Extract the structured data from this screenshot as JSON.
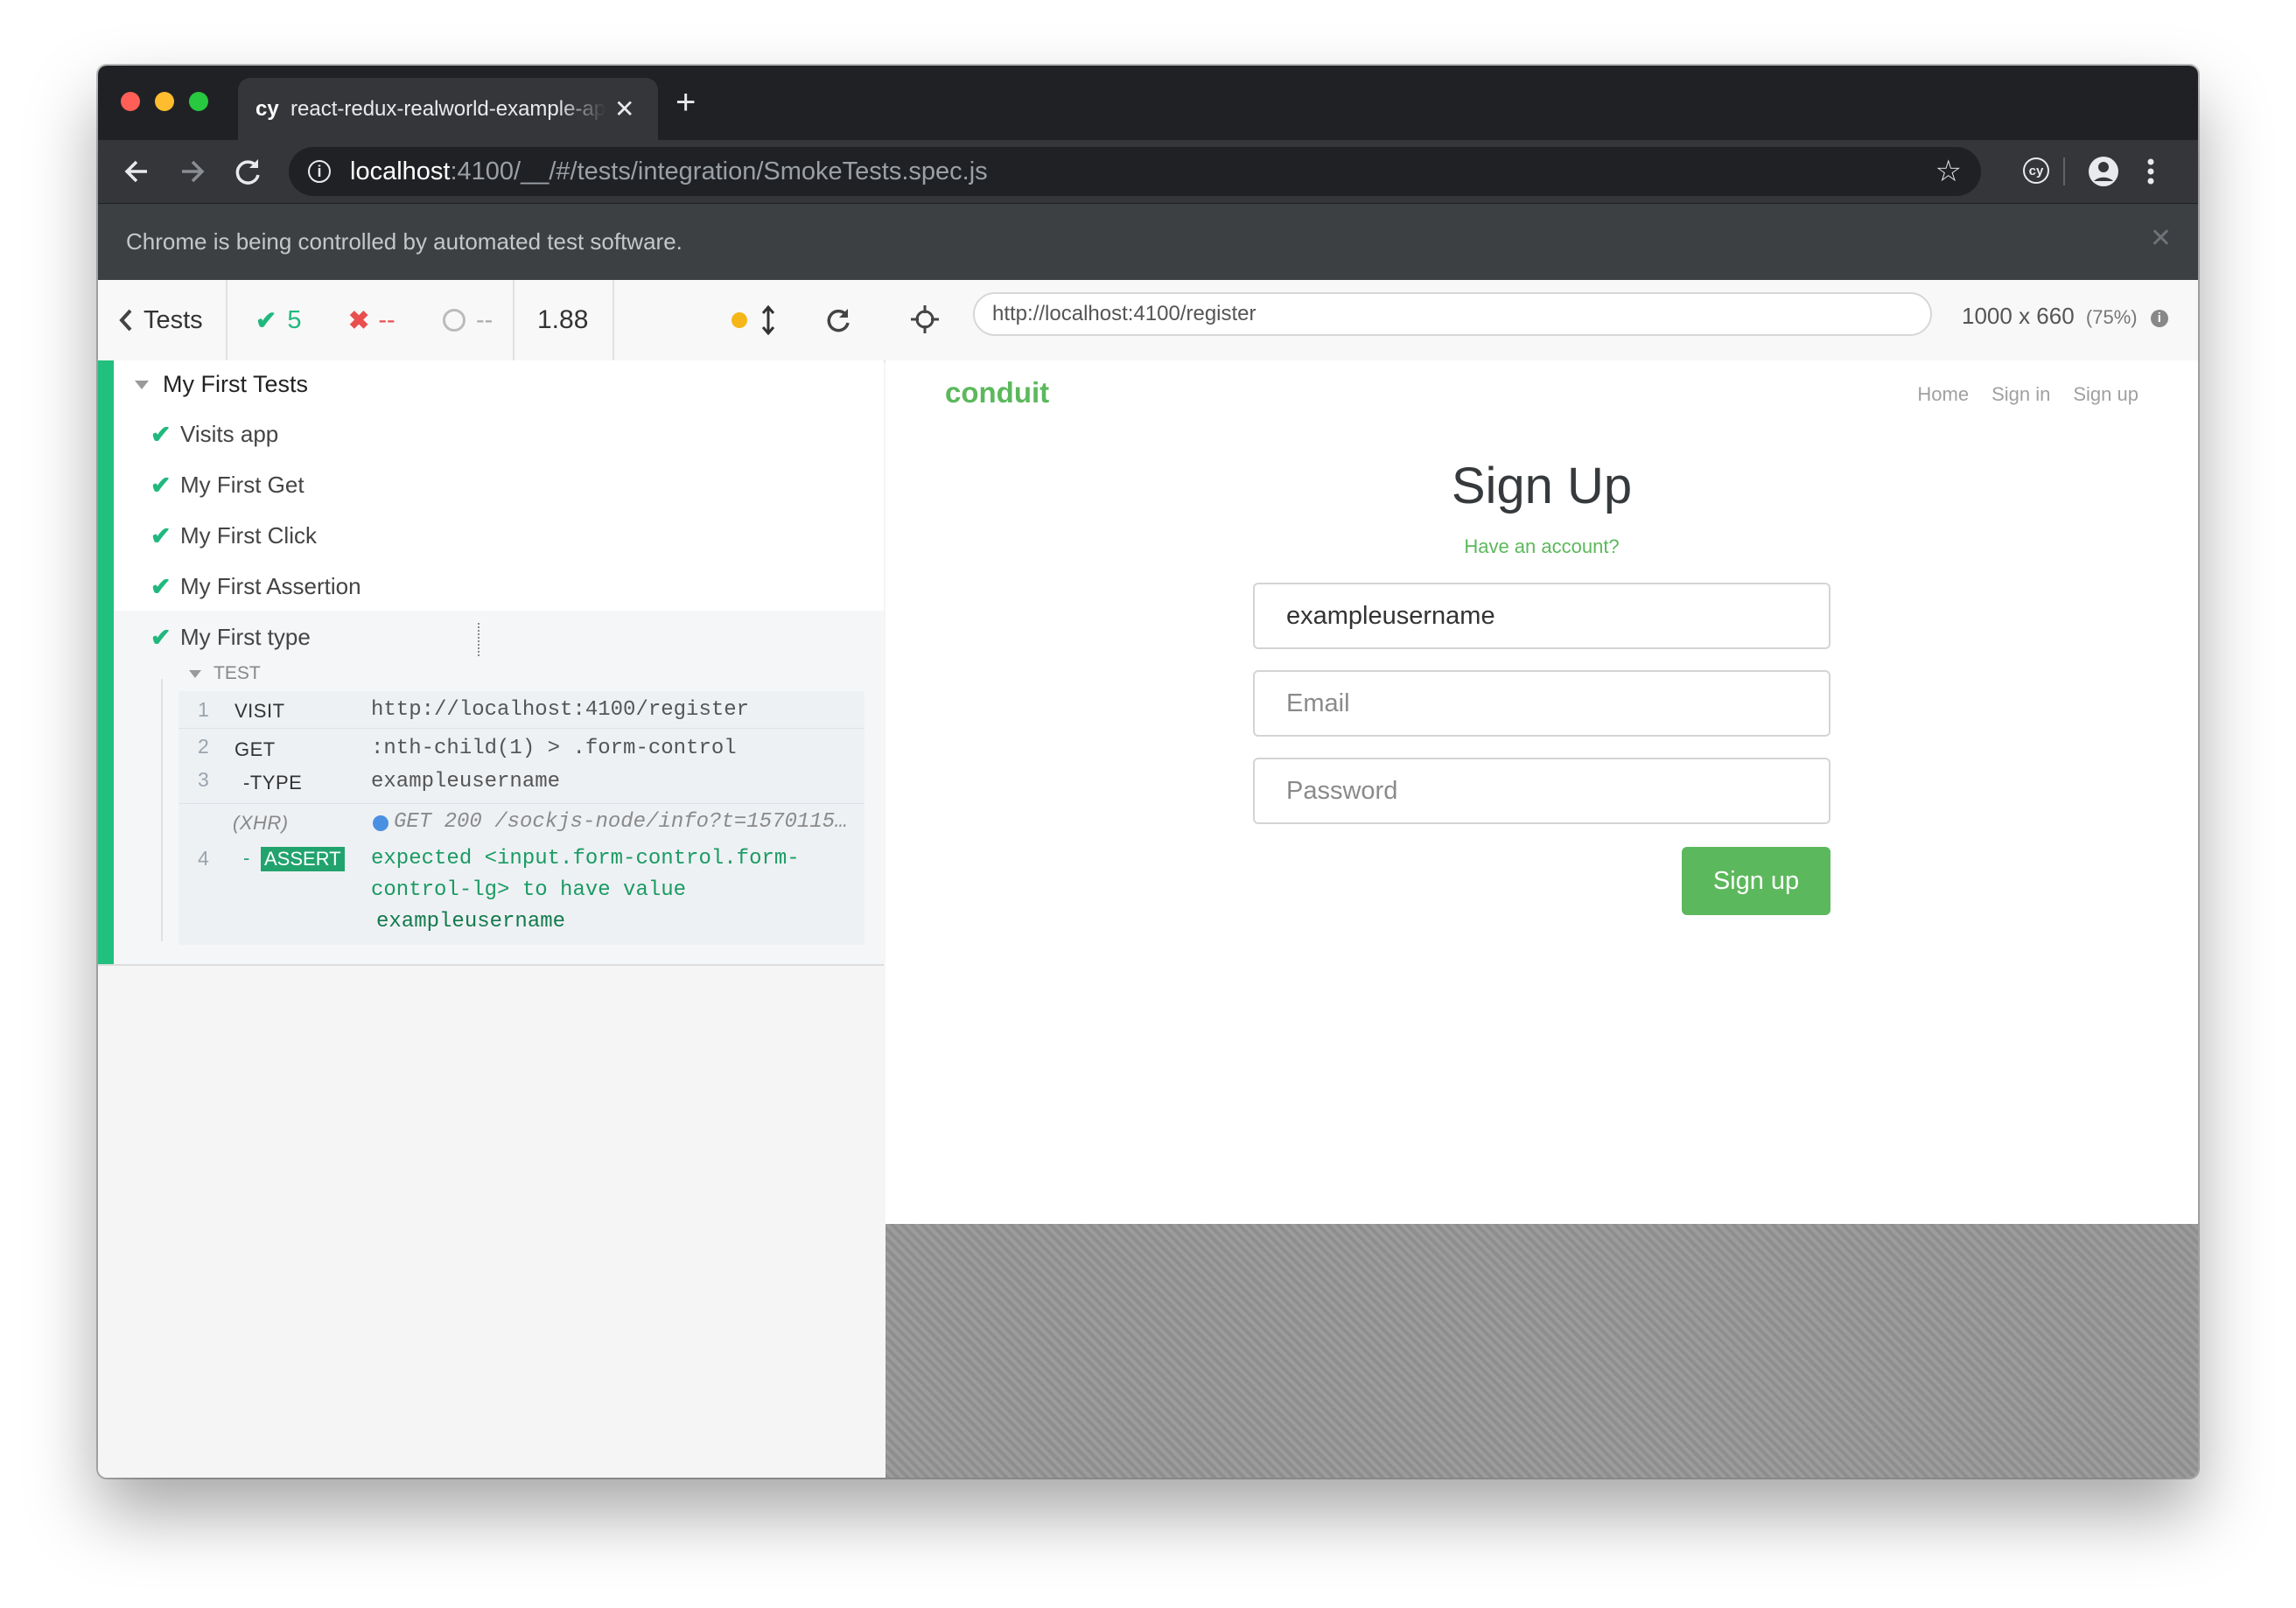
{
  "browser": {
    "tab": {
      "favicon": "cy",
      "title": "react-redux-realworld-example-app",
      "close": "✕"
    },
    "new_tab": "+",
    "url": {
      "host": "localhost",
      "rest": ":4100/__/#/tests/integration/SmokeTests.spec.js"
    },
    "infobar": {
      "text": "Chrome is being controlled by automated test software.",
      "close": "✕"
    },
    "extension_label": "cy"
  },
  "reporter": {
    "tests_label": "Tests",
    "passed_count": "5",
    "failed_count": "--",
    "pending_count": "--",
    "duration": "1.88",
    "suite": {
      "title": "My First Tests",
      "tests": [
        "Visits app",
        "My First Get",
        "My First Click",
        "My First Assertion",
        "My First type"
      ]
    },
    "hook_label": "TEST",
    "commands": [
      {
        "num": "1",
        "name": "VISIT",
        "message": "http://localhost:4100/register"
      },
      {
        "num": "2",
        "name": "GET",
        "message": ":nth-child(1) > .form-control"
      },
      {
        "num": "3",
        "name": "-TYPE",
        "message": "exampleusername"
      },
      {
        "num": "",
        "name": "(XHR)",
        "message": "GET 200 /sockjs-node/info?t=1570115…"
      },
      {
        "num": "4",
        "name": "ASSERT",
        "prefix": "-",
        "message_line1": "expected <input.form-control.form-",
        "message_line2": "control-lg> to have value",
        "message_line3": "exampleusername"
      }
    ]
  },
  "aut": {
    "url": "http://localhost:4100/register",
    "viewport": "1000 x 660",
    "scale": "(75%)"
  },
  "app": {
    "brand": "conduit",
    "nav": [
      "Home",
      "Sign in",
      "Sign up"
    ],
    "title": "Sign Up",
    "have_account": "Have an account?",
    "username_value": "exampleusername",
    "email_placeholder": "Email",
    "password_placeholder": "Password",
    "submit_label": "Sign up",
    "accent": "#5cb85c"
  },
  "colors": {
    "pass": "#21c07e",
    "fail": "#e94f4f",
    "assert_bg": "#21a36d"
  }
}
